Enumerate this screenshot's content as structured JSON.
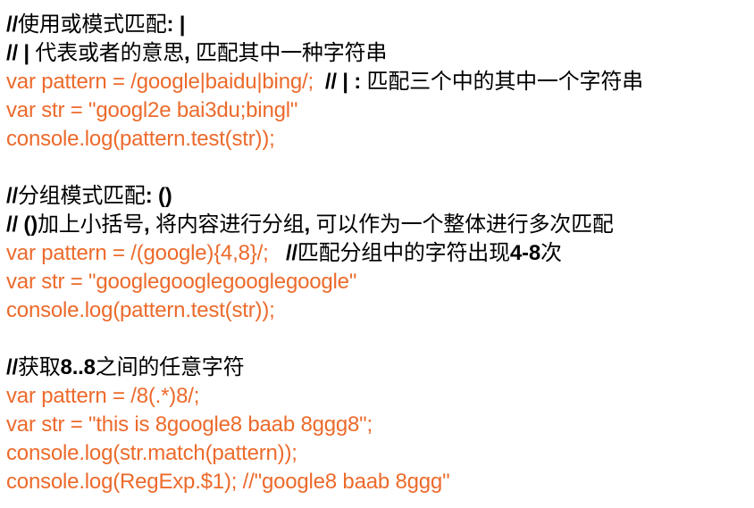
{
  "colors": {
    "code": "#ec6a2b",
    "comment": "#000000",
    "background": "#ffffff"
  },
  "block1": {
    "c1_a": "//",
    "c1_b": "使用或模式匹配",
    "c1_c": ": |",
    "c2_a": "// | ",
    "c2_b": "代表或者的意思",
    "c2_c": ", ",
    "c2_d": "匹配其中一种字符串",
    "code1": "var pattern = /google|baidu|bing/;  ",
    "code1_comment_a": "// | : ",
    "code1_comment_b": "匹配三个中的其中一个字符串",
    "code2": "var str = \"googl2e bai3du;bingl\"",
    "code3": "console.log(pattern.test(str));"
  },
  "block2": {
    "c1_a": "//",
    "c1_b": "分组模式匹配",
    "c1_c": ": ()",
    "c2_a": "// ()",
    "c2_b": "加上小括号",
    "c2_c": ", ",
    "c2_d": "将内容进行分组",
    "c2_e": ", ",
    "c2_f": "可以作为一个整体进行多次匹配",
    "code1": "var pattern = /(google){4,8}/;   ",
    "code1_comment_a": "//",
    "code1_comment_b": "匹配分组中的字符出现",
    "code1_comment_c": "4-8",
    "code1_comment_d": "次",
    "code2": "var str = \"googlegooglegooglegoogle\"",
    "code3": "console.log(pattern.test(str));"
  },
  "block3": {
    "c1_a": "//",
    "c1_b": "获取",
    "c1_c": "8..8",
    "c1_d": "之间的任意字符",
    "code1": "var pattern = /8(.*)8/;",
    "code2": "var str = \"this is 8google8 baab 8ggg8\";",
    "code3": "console.log(str.match(pattern));",
    "code4": "console.log(RegExp.$1); //\"google8 baab 8ggg\""
  }
}
